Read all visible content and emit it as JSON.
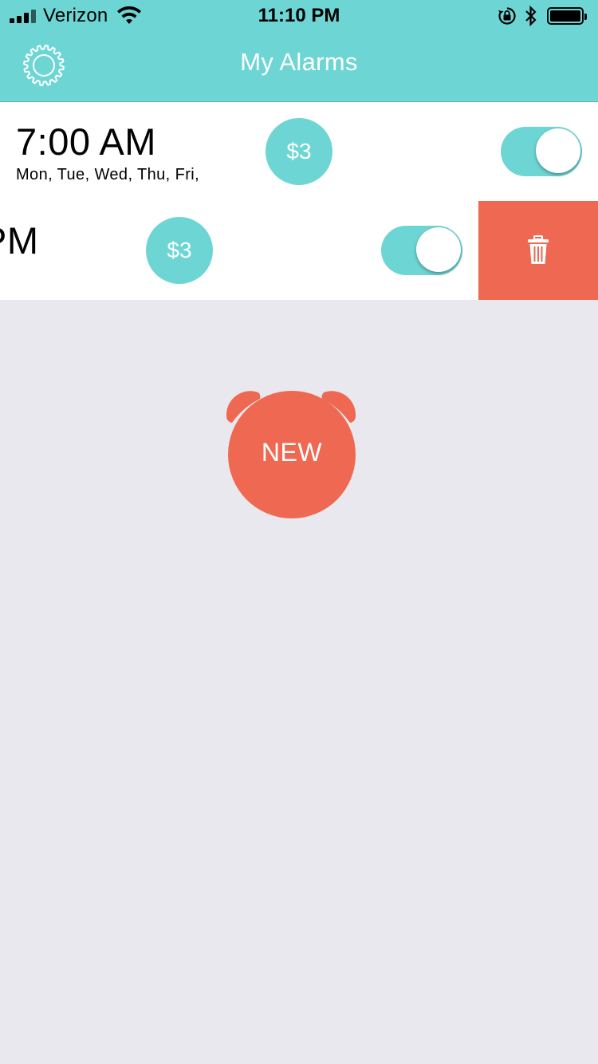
{
  "status_bar": {
    "carrier": "Verizon",
    "time": "11:10 PM",
    "icons": [
      "signal-icon",
      "wifi-icon",
      "rotation-lock-icon",
      "bluetooth-icon",
      "battery-icon"
    ],
    "battery_level": 1.0
  },
  "nav": {
    "title": "My Alarms",
    "settings_icon": "gear-icon"
  },
  "alarms": [
    {
      "time": "7:00 AM",
      "days": "Mon, Tue, Wed, Thu, Fri,",
      "price": "$3",
      "enabled": true
    },
    {
      "time": "PM",
      "days": "",
      "price": "$3",
      "enabled": true,
      "delete_icon": "trash-icon"
    }
  ],
  "new_button": {
    "label": "NEW",
    "icon": "alarm-clock-icon"
  },
  "colors": {
    "accent": "#6dd6d4",
    "danger": "#ee6852",
    "background": "#e9e8ee",
    "row_background": "#ffffff"
  }
}
